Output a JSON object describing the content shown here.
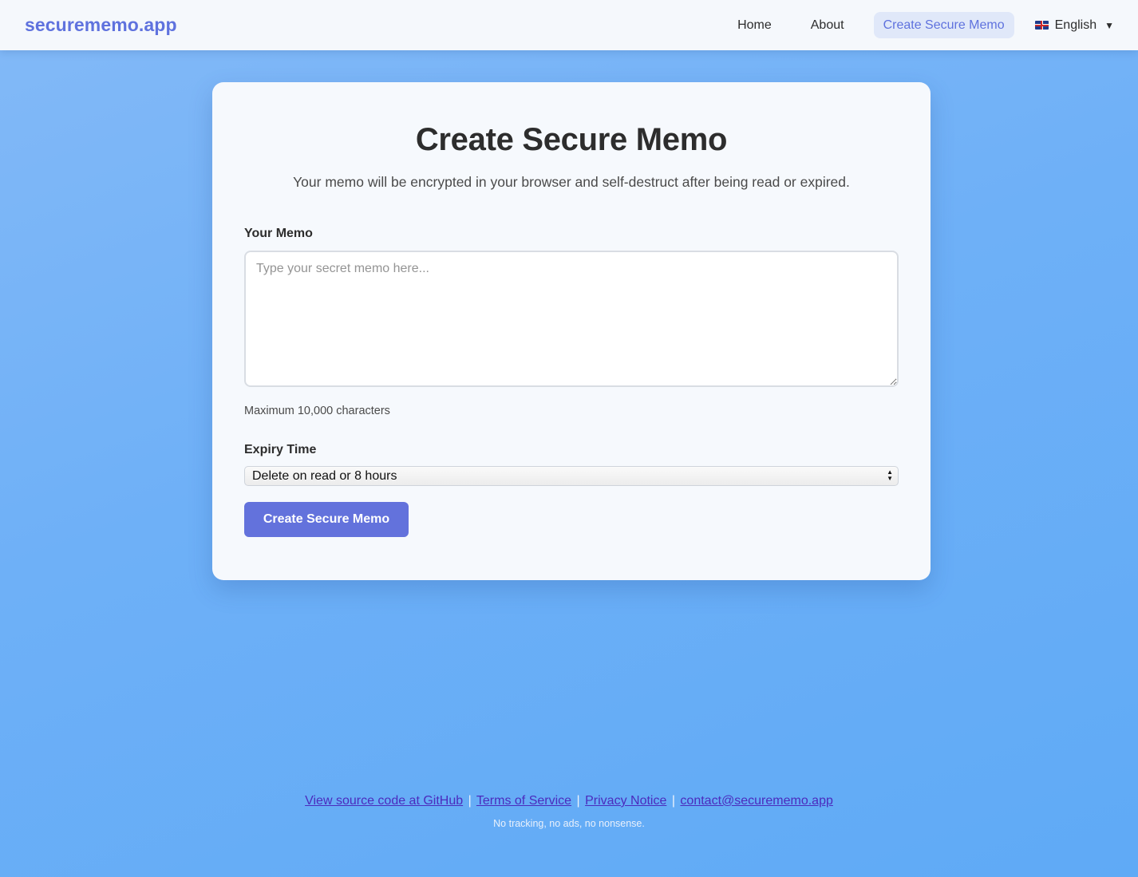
{
  "nav": {
    "brand": "securememo.app",
    "links": [
      {
        "label": "Home"
      },
      {
        "label": "About"
      },
      {
        "label": "Create Secure Memo",
        "active": true
      }
    ],
    "language": {
      "flag_icon": "uk-flag-icon",
      "label": "English",
      "caret": "▼"
    }
  },
  "form": {
    "title": "Create Secure Memo",
    "subtitle": "Your memo will be encrypted in your browser and self-destruct after being read or expired.",
    "memo_label": "Your Memo",
    "memo_placeholder": "Type your secret memo here...",
    "memo_value": "",
    "memo_hint": "Maximum 10,000 characters",
    "expiry_label": "Expiry Time",
    "expiry_selected": "Delete on read or 8 hours",
    "submit_label": "Create Secure Memo"
  },
  "footer": {
    "links": [
      {
        "label": "View source code at GitHub"
      },
      {
        "label": "Terms of Service"
      },
      {
        "label": "Privacy Notice"
      },
      {
        "label": "contact@securememo.app"
      }
    ],
    "separator": "|",
    "tagline": "No tracking, no ads, no nonsense."
  },
  "colors": {
    "brand": "#5f72de",
    "button": "#6372dc",
    "active_nav_bg": "#e0e8f9",
    "background_gradient": [
      "#83b9f7",
      "#5faaf6"
    ],
    "footer_link": "#4b2bbd"
  }
}
